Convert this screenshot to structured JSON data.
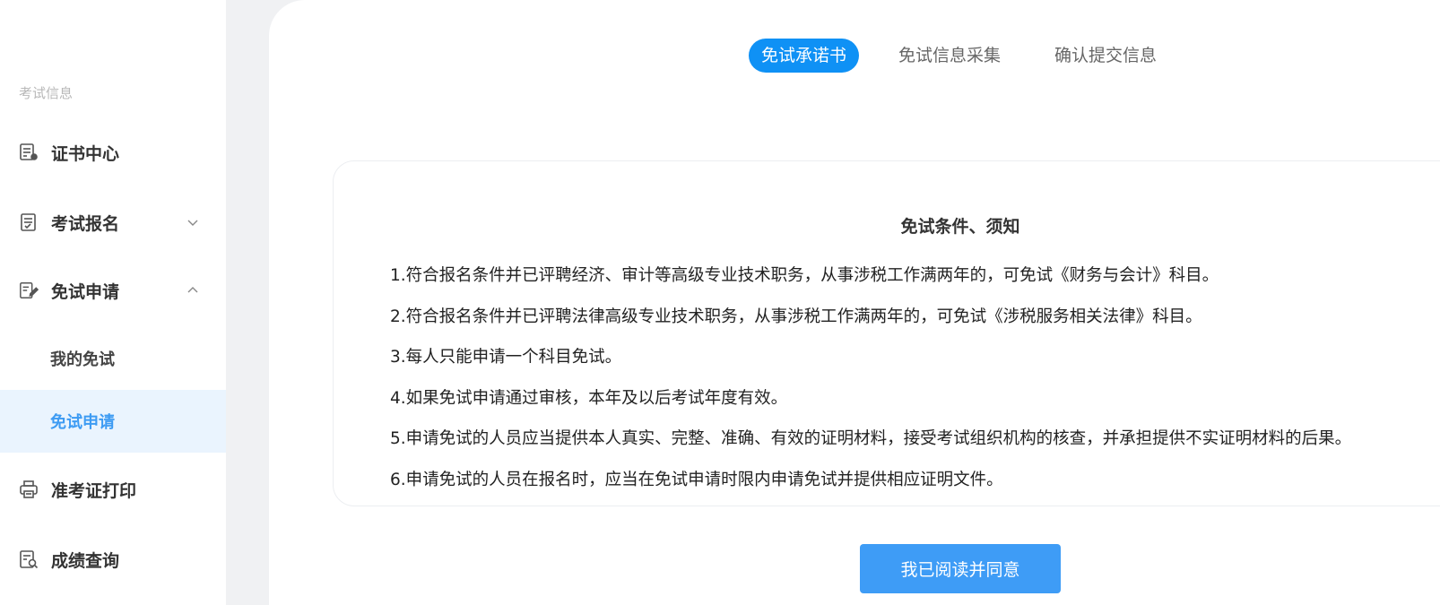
{
  "sidebar": {
    "section_title": "考试信息",
    "menu": [
      {
        "label": "证书中心",
        "icon": "certificate-icon"
      },
      {
        "label": "考试报名",
        "icon": "registration-icon",
        "expanded": false
      },
      {
        "label": "免试申请",
        "icon": "edit-document-icon",
        "expanded": true
      },
      {
        "label": "准考证打印",
        "icon": "printer-icon"
      },
      {
        "label": "成绩查询",
        "icon": "score-search-icon"
      }
    ],
    "submenu": [
      {
        "label": "我的免试",
        "active": false
      },
      {
        "label": "免试申请",
        "active": true
      }
    ]
  },
  "steps": [
    {
      "label": "免试承诺书",
      "active": true
    },
    {
      "label": "免试信息采集",
      "active": false
    },
    {
      "label": "确认提交信息",
      "active": false
    }
  ],
  "notice": {
    "title": "免试条件、须知",
    "items": [
      "1.符合报名条件并已评聘经济、审计等高级专业技术职务，从事涉税工作满两年的，可免试《财务与会计》科目。",
      "2.符合报名条件并已评聘法律高级专业技术职务，从事涉税工作满两年的，可免试《涉税服务相关法律》科目。",
      "3.每人只能申请一个科目免试。",
      "4.如果免试申请通过审核，本年及以后考试年度有效。",
      "5.申请免试的人员应当提供本人真实、完整、准确、有效的证明材料，接受考试组织机构的核查，并承担提供不实证明材料的后果。",
      "6.申请免试的人员在报名时，应当在免试申请时限内申请免试并提供相应证明文件。"
    ]
  },
  "agree_button_label": "我已阅读并同意",
  "colors": {
    "accent": "#0f91f5",
    "active_sub_bg": "#eaf4fe",
    "active_sub_text": "#3d9bf3",
    "button_bg": "#3e9cf6"
  }
}
